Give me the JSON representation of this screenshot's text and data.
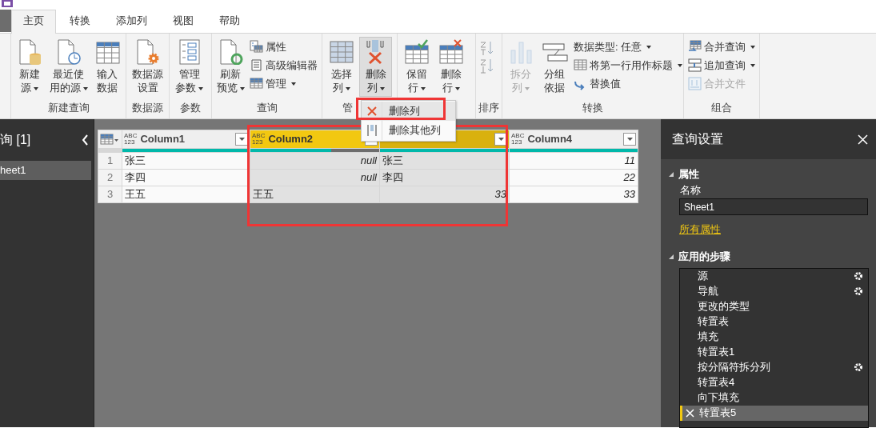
{
  "tabs": [
    {
      "label": "主页",
      "selected": true
    },
    {
      "label": "转换",
      "selected": false
    },
    {
      "label": "添加列",
      "selected": false
    },
    {
      "label": "视图",
      "selected": false
    },
    {
      "label": "帮助",
      "selected": false
    }
  ],
  "ribbon": {
    "groups": [
      {
        "label": "新建查询",
        "buttons": [
          {
            "kind": "large",
            "lines": [
              "新建",
              "源"
            ],
            "dropdown": true,
            "pressed": false,
            "disabled": false
          },
          {
            "kind": "large",
            "lines": [
              "最近使",
              "用的源"
            ],
            "dropdown": true,
            "pressed": false,
            "disabled": false
          },
          {
            "kind": "large",
            "lines": [
              "输入",
              "数据"
            ],
            "dropdown": false,
            "pressed": false,
            "disabled": false
          }
        ]
      },
      {
        "label": "数据源",
        "buttons": [
          {
            "kind": "large",
            "lines": [
              "数据源",
              "设置"
            ],
            "dropdown": false,
            "pressed": false,
            "disabled": false
          }
        ]
      },
      {
        "label": "参数",
        "buttons": [
          {
            "kind": "large",
            "lines": [
              "管理",
              "参数"
            ],
            "dropdown": true,
            "pressed": false,
            "disabled": false
          }
        ]
      },
      {
        "label": "查询",
        "buttons": [
          {
            "kind": "large",
            "lines": [
              "刷新",
              "预览"
            ],
            "dropdown": true,
            "pressed": false,
            "disabled": false
          },
          {
            "kind": "stack",
            "items": [
              {
                "label": "属性",
                "dropdown": false,
                "disabled": false
              },
              {
                "label": "高级编辑器",
                "dropdown": false,
                "disabled": false
              },
              {
                "label": "管理",
                "dropdown": true,
                "disabled": false
              }
            ]
          }
        ]
      },
      {
        "label": "管",
        "buttons": [
          {
            "kind": "large",
            "lines": [
              "选择",
              "列"
            ],
            "dropdown": true,
            "pressed": false,
            "disabled": false
          },
          {
            "kind": "large",
            "lines": [
              "删除",
              "列"
            ],
            "dropdown": true,
            "pressed": true,
            "disabled": false
          }
        ]
      },
      {
        "buttons": [
          {
            "kind": "large",
            "lines": [
              "保留",
              "行"
            ],
            "dropdown": true,
            "pressed": false,
            "disabled": false
          },
          {
            "kind": "large",
            "lines": [
              "删除",
              "行"
            ],
            "dropdown": true,
            "pressed": false,
            "disabled": false
          }
        ]
      },
      {
        "label": "排序",
        "buttons": [
          {
            "kind": "sort"
          }
        ]
      },
      {
        "label": "转换",
        "buttons": [
          {
            "kind": "large",
            "lines": [
              "拆分",
              "列"
            ],
            "dropdown": true,
            "pressed": false,
            "disabled": true
          },
          {
            "kind": "large",
            "lines": [
              "分组",
              "依据"
            ],
            "dropdown": false,
            "pressed": false,
            "disabled": false
          },
          {
            "kind": "stack",
            "items": [
              {
                "label": "数据类型: 任意",
                "dropdown": true,
                "disabled": false
              },
              {
                "label": "将第一行用作标题",
                "dropdown": true,
                "disabled": false
              },
              {
                "label": "替换值",
                "dropdown": false,
                "disabled": false
              }
            ]
          }
        ]
      },
      {
        "label": "组合",
        "buttons": [
          {
            "kind": "stack",
            "items": [
              {
                "label": "合并查询",
                "dropdown": true,
                "disabled": false
              },
              {
                "label": "追加查询",
                "dropdown": true,
                "disabled": false
              },
              {
                "label": "合并文件",
                "dropdown": false,
                "disabled": true
              }
            ]
          }
        ]
      }
    ]
  },
  "dropdown_menu": {
    "items": [
      {
        "label": "删除列",
        "selected": true
      },
      {
        "label": "删除其他列",
        "selected": false
      }
    ]
  },
  "queries_pane": {
    "title": "询 [1]",
    "items": [
      {
        "label": "heet1",
        "selected": true
      }
    ]
  },
  "table": {
    "columns": [
      {
        "type_label": "ABC 123",
        "name": "Column1",
        "selected": false,
        "level": 1
      },
      {
        "type_label": "ABC 123",
        "name": "Column2",
        "selected": true,
        "level": 0.63
      },
      {
        "selected": true,
        "level": 1
      },
      {
        "type_label": "ABC 123",
        "name": "Column4",
        "selected": false,
        "level": 1
      }
    ],
    "rows": [
      {
        "number": "1",
        "cells": [
          {
            "kind": "text",
            "text": "张三"
          },
          {
            "kind": "null",
            "text": "null"
          },
          {
            "kind": "text",
            "text": "张三"
          },
          {
            "kind": "number",
            "text": "11"
          }
        ]
      },
      {
        "number": "2",
        "cells": [
          {
            "kind": "text",
            "text": "李四"
          },
          {
            "kind": "null",
            "text": "null"
          },
          {
            "kind": "text",
            "text": "李四"
          },
          {
            "kind": "number",
            "text": "22"
          }
        ]
      },
      {
        "number": "3",
        "cells": [
          {
            "kind": "text",
            "text": "王五"
          },
          {
            "kind": "text",
            "text": "王五"
          },
          {
            "kind": "number",
            "text": "33"
          },
          {
            "kind": "number",
            "text": "33"
          }
        ]
      }
    ]
  },
  "query_settings": {
    "title": "查询设置",
    "properties": {
      "heading": "属性",
      "name_label": "名称",
      "name_value": "Sheet1",
      "all_properties_link": "所有属性"
    },
    "applied_steps": {
      "heading": "应用的步骤",
      "steps": [
        {
          "label": "源",
          "settings": true,
          "selected": false
        },
        {
          "label": "导航",
          "settings": true,
          "selected": false
        },
        {
          "label": "更改的类型",
          "settings": false,
          "selected": false
        },
        {
          "label": "转置表",
          "settings": false,
          "selected": false
        },
        {
          "label": "填充",
          "settings": false,
          "selected": false
        },
        {
          "label": "转置表1",
          "settings": false,
          "selected": false
        },
        {
          "label": "按分隔符拆分列",
          "settings": true,
          "selected": false
        },
        {
          "label": "转置表4",
          "settings": false,
          "selected": false
        },
        {
          "label": "向下填充",
          "settings": false,
          "selected": false
        },
        {
          "label": "转置表5",
          "settings": false,
          "selected": true
        }
      ]
    }
  }
}
